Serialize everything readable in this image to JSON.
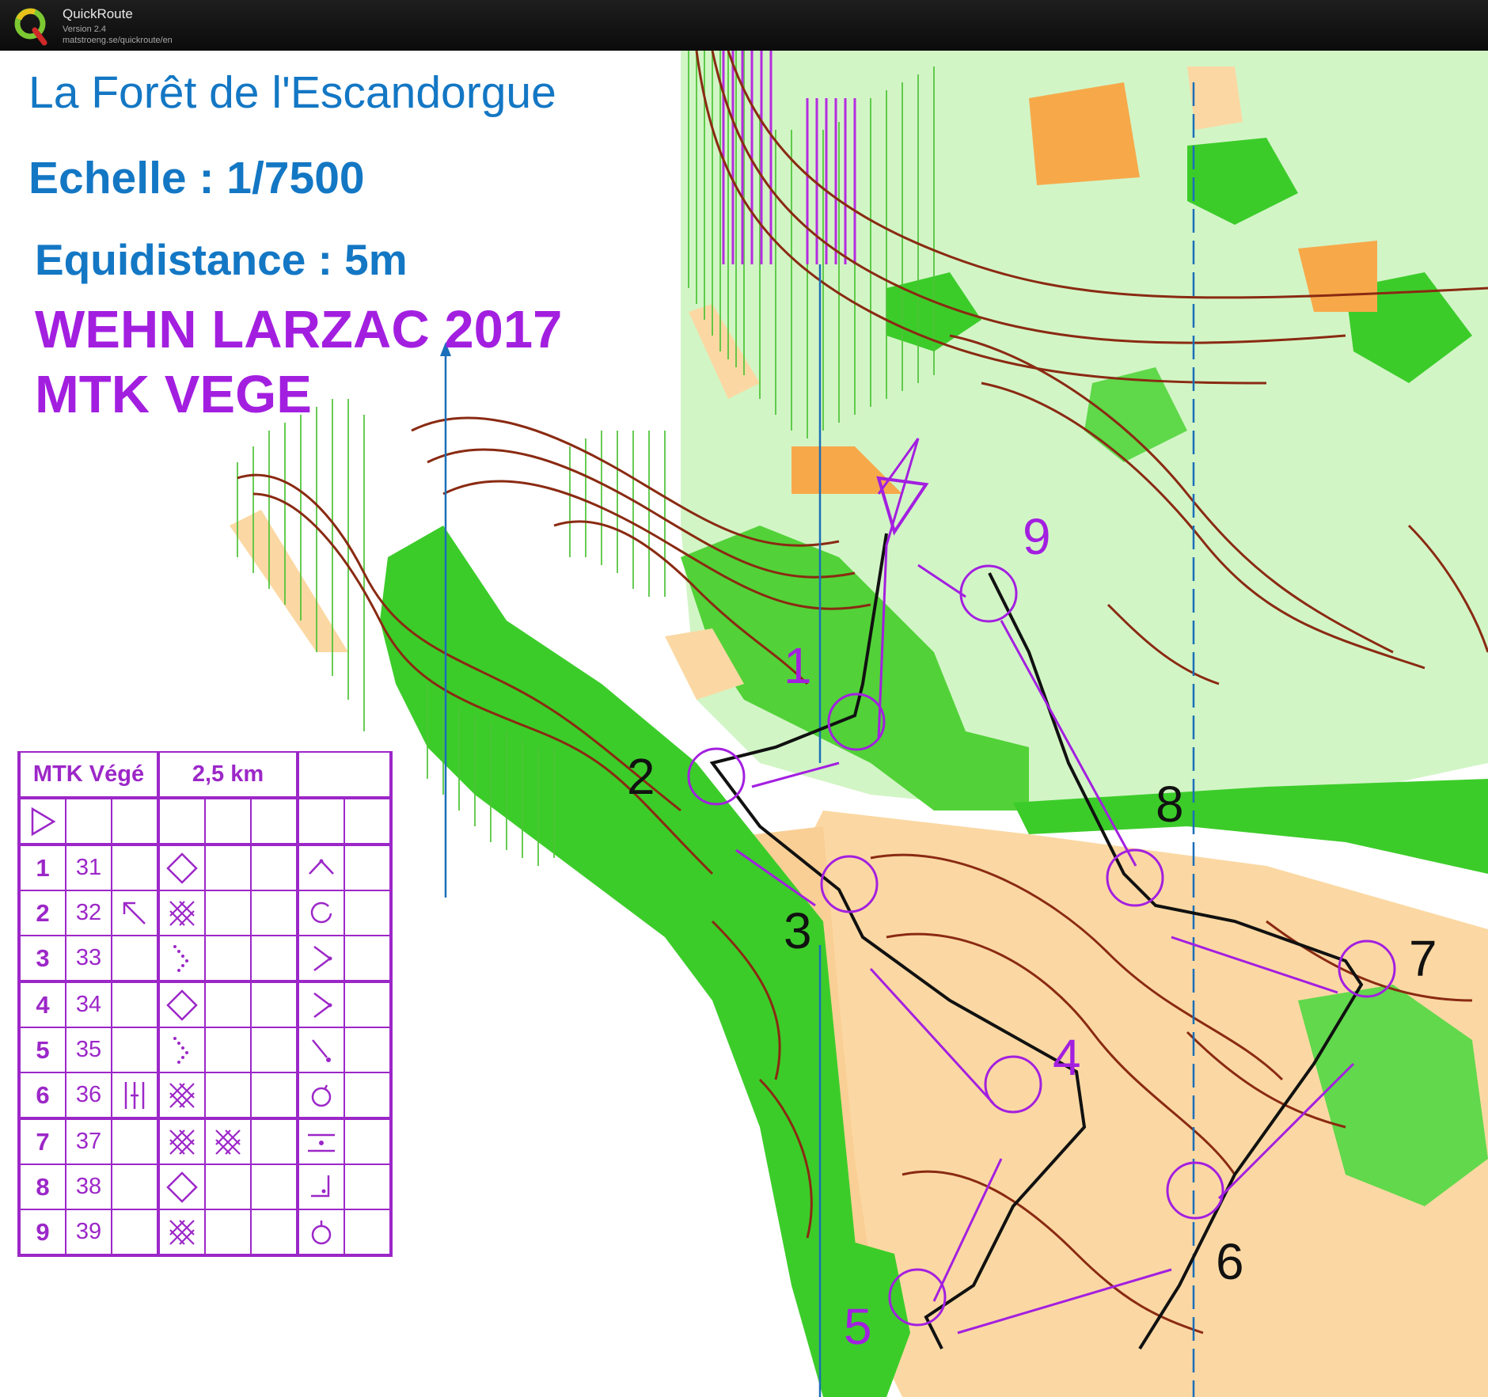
{
  "app": {
    "name": "QuickRoute",
    "version": "Version 2.4",
    "url": "matstroeng.se/quickroute/en"
  },
  "map": {
    "title": "La Forêt de l'Escandorgue",
    "scale": "Echelle : 1/7500",
    "contour_interval": "Equidistance : 5m",
    "event": "WEHN LARZAC 2017",
    "category": "MTK VEGE",
    "colors": {
      "title_blue": "#1377c4",
      "course_purple": "#a31fe0",
      "route_black": "#111111",
      "vegetation_green": "#3ccc2a",
      "light_green": "#b6efa7",
      "open_yellow": "#fbd8a3",
      "contour_brown": "#8a2a12",
      "north_line_blue": "#1b6fb8"
    },
    "control_labels": [
      "1",
      "2",
      "3",
      "4",
      "5",
      "6",
      "7",
      "8",
      "9"
    ]
  },
  "control_description": {
    "course": "MTK Végé",
    "length": "2,5 km",
    "start_symbol": "start-triangle-icon",
    "rows": [
      {
        "number": "1",
        "code": "31",
        "direction": "",
        "feature": "diamond-icon",
        "feature2": "",
        "detail": "caret-up-icon"
      },
      {
        "number": "2",
        "code": "32",
        "direction": "arrow-northwest-icon",
        "feature": "thicket-icon",
        "feature2": "",
        "detail": "circle-open-icon"
      },
      {
        "number": "3",
        "code": "33",
        "direction": "",
        "feature": "dotted-corner-icon",
        "feature2": "",
        "detail": "angle-right-icon"
      },
      {
        "number": "4",
        "code": "34",
        "direction": "",
        "feature": "diamond-icon",
        "feature2": "",
        "detail": "angle-right-icon"
      },
      {
        "number": "5",
        "code": "35",
        "direction": "",
        "feature": "dotted-corner-icon",
        "feature2": "",
        "detail": "foot-dot-icon"
      },
      {
        "number": "6",
        "code": "36",
        "direction": "fence-gap-icon",
        "feature": "thicket-icon",
        "feature2": "",
        "detail": "circle-notch-icon"
      },
      {
        "number": "7",
        "code": "37",
        "direction": "",
        "feature": "thicket-icon",
        "feature2": "thicket-icon",
        "detail": "between-icon"
      },
      {
        "number": "8",
        "code": "38",
        "direction": "",
        "feature": "diamond-icon",
        "feature2": "",
        "detail": "corner-icon"
      },
      {
        "number": "9",
        "code": "39",
        "direction": "",
        "feature": "thicket-icon",
        "feature2": "",
        "detail": "circle-top-icon"
      }
    ]
  }
}
